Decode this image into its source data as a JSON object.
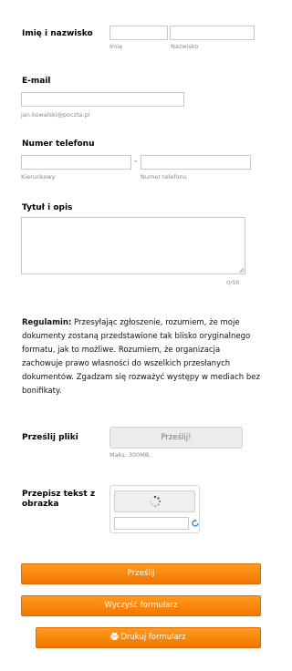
{
  "name": {
    "label": "Imię i nazwisko",
    "first_hint": "Imię",
    "last_hint": "Nazwisko",
    "first_value": "",
    "last_value": ""
  },
  "email": {
    "label": "E-mail",
    "hint": "jan.kowalski@poczta.pl",
    "value": ""
  },
  "phone": {
    "label": "Numer telefonu",
    "separator": "-",
    "area_hint": "Kierunkowy",
    "number_hint": "Numer telefonu"
  },
  "description": {
    "label": "Tytuł i opis",
    "counter": "0/50",
    "value": ""
  },
  "terms": {
    "bold": "Regulamin:",
    "text": " Przesyłając zgłoszenie, rozumiem, że moje dokumenty zostaną przedstawione tak blisko oryginalnego formatu, jak to możliwe. Rozumiem, że organizacja zachowuje prawo własności do wszelkich przesłanych dokumentów. Zgadzam się rozważyć występy w mediach bez bonifikaty."
  },
  "upload": {
    "label": "Prześlij pliki",
    "button": "Prześlij!",
    "hint": "Maks. 300MB."
  },
  "captcha": {
    "label": "Przepisz tekst z obrazka",
    "spinner_icon": "loading-spinner-icon",
    "refresh_icon": "refresh-icon"
  },
  "actions": {
    "submit": "Prześlij",
    "clear": "Wyczyść formularz",
    "print": "Drukuj formularz",
    "print_icon": "printer-icon"
  },
  "colors": {
    "accent": "#f5820d",
    "field_border": "#c8c8c8",
    "hint": "#888888"
  }
}
